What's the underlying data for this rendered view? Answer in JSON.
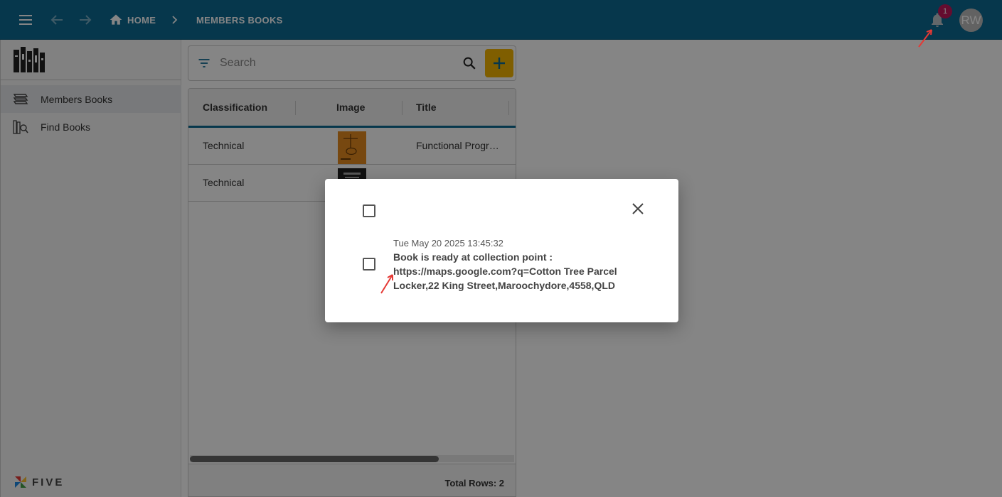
{
  "header": {
    "home_label": "HOME",
    "current_page": "MEMBERS BOOKS",
    "notification_count": "1",
    "avatar_initials": "RW",
    "bar_color": "#0c6a93"
  },
  "sidebar": {
    "items": [
      {
        "label": "Members Books",
        "icon": "books-stack-icon",
        "active": true
      },
      {
        "label": "Find Books",
        "icon": "book-search-icon",
        "active": false
      }
    ],
    "footer_brand": "FIVE"
  },
  "search": {
    "placeholder": "Search"
  },
  "table": {
    "columns": [
      "Classification",
      "Image",
      "Title"
    ],
    "rows": [
      {
        "classification": "Technical",
        "title": "Functional Progr…"
      },
      {
        "classification": "Technical",
        "title": ""
      }
    ],
    "total_rows_text": "Total Rows: 2"
  },
  "dialog": {
    "notification": {
      "timestamp": "Tue May 20 2025 13:45:32",
      "message": "Book is ready at collection point : https://maps.google.com?q=Cotton Tree Parcel Locker,22 King Street,Maroochydore,4558,QLD"
    }
  },
  "colors": {
    "accent": "#0c6a93",
    "add_button": "#f4b400",
    "badge": "#c2185b",
    "annotation_arrow": "#e53935"
  }
}
